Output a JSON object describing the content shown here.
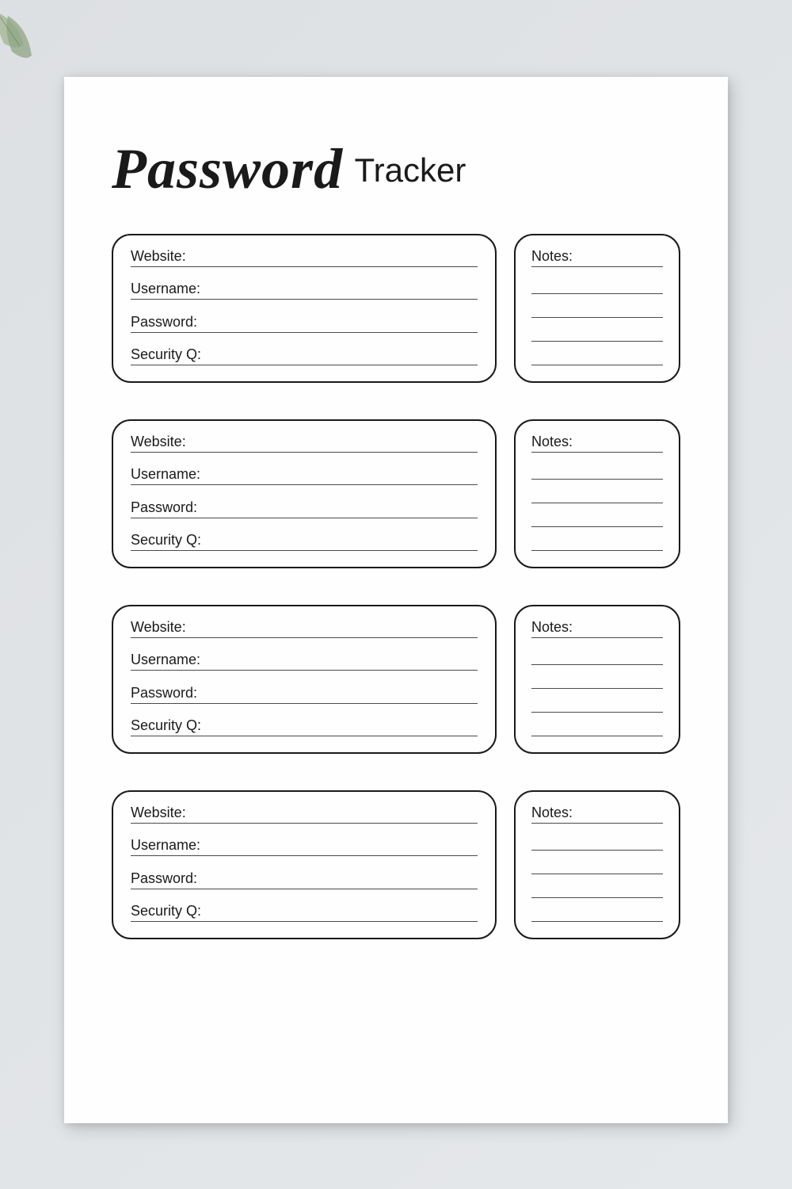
{
  "title": {
    "script": "Password",
    "sans": "Tracker"
  },
  "labels": {
    "website": "Website:",
    "username": "Username:",
    "password": "Password:",
    "security_q": "Security Q:",
    "notes": "Notes:"
  },
  "entries": [
    {
      "website": "",
      "username": "",
      "password": "",
      "security_q": "",
      "notes": ""
    },
    {
      "website": "",
      "username": "",
      "password": "",
      "security_q": "",
      "notes": ""
    },
    {
      "website": "",
      "username": "",
      "password": "",
      "security_q": "",
      "notes": ""
    },
    {
      "website": "",
      "username": "",
      "password": "",
      "security_q": "",
      "notes": ""
    }
  ],
  "colors": {
    "background": "#e3e6e9",
    "paper": "#fefefe",
    "border": "#1a1a1a",
    "line": "#4a4a4a"
  }
}
